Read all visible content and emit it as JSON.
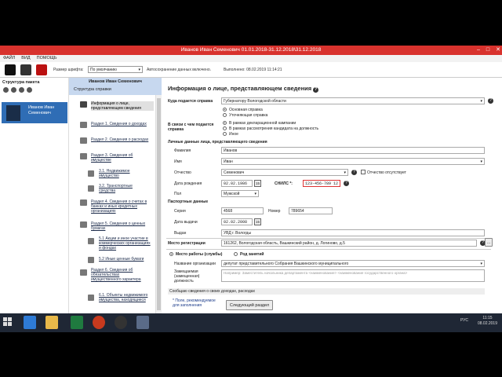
{
  "window": {
    "title": "Иванов Иван Семенович 01.01.2018-31.12.2018\\31.12.2018"
  },
  "menu": [
    "ФАЙЛ",
    "ВИД",
    "ПОМОЩЬ"
  ],
  "toolbar": {
    "font_size_label": "Размер шрифта:",
    "font_size_value": "По умолчанию",
    "autosave_text": "Автосохранение данных включено.",
    "done_text": "Выполнено: 08.02.2019 11:14:21"
  },
  "left_panel": {
    "title": "Структура пакета",
    "user_name": "Иванов Иван Семенович"
  },
  "mid_panel": {
    "header_name": "Иванов Иван Семенович",
    "subtitle": "Структура справки",
    "items": [
      "Информация о лице, представляющем сведения",
      "Раздел 1. Сведения о доходах",
      "Раздел 2. Сведения о расходах",
      "Раздел 3. Сведения об имуществе",
      "3.1. Недвижимое имущество",
      "3.2. Транспортные средства",
      "Раздел 4. Сведения о счетах в банках и иных кредитных организациях",
      "Раздел 5. Сведения о ценных бумагах",
      "5.1 Акции и иное участие в коммерческих организациях и фондах",
      "5.2 Иные ценные бумаги",
      "Раздел 6. Сведения об обязательствах имущественного характера",
      "6.1. Объекты недвижимого имущества, находящиеся"
    ]
  },
  "form": {
    "heading": "Информация о лице, представляющем сведения",
    "where_label": "Куда подается справка",
    "where_value": "Губернатору Вологодской области",
    "radio_main": "Основная справка",
    "radio_clarify": "Уточняющая справка",
    "reason_label": "В связи с чем подается справка",
    "reason_1": "В рамках декларационной кампании",
    "reason_2": "В рамках рассмотрения кандидата на должность",
    "reason_3": "Иное",
    "personal_title": "Личные данные лица, представляющего сведения",
    "surname_label": "Фамилия",
    "surname_value": "Иванов",
    "name_label": "Имя",
    "name_value": "Иван",
    "patronymic_label": "Отчество",
    "patronymic_value": "Семенович",
    "no_patronymic_label": "Отчество отсутствует",
    "birthdate_label": "Дата рождения",
    "birthdate_value": "02.02.1986",
    "snils_label": "СНИЛС *:",
    "snils_value": "123-456-789 12",
    "sex_label": "Пол",
    "sex_value": "Мужской",
    "passport_title": "Паспортные данные",
    "series_label": "Серия",
    "series_value": "4568",
    "number_label": "Номер",
    "number_value": "789654",
    "issued_date_label": "Дата выдачи",
    "issued_date_value": "02.02.2008",
    "issued_by_label": "Выдан",
    "issued_by_value": "УВД г. Вологды",
    "reg_label": "Место регистрации",
    "reg_value": "161262, Вологодская область, Вашкинский район, д. Логиново, д.5",
    "work_radio": "Место работы (службы)",
    "noemp_radio": "Род занятий",
    "org_label": "Название организации",
    "org_value": "депутат представительного Собрания Вашкинского муниципального",
    "position_label": "Замещаемая (замещенная) должность",
    "position_placeholder": "Например: Заместитель начальника департамента <наименование> <наименование государственного органа>",
    "income_note": "Сообщаю сведения о своих доходах, расходах",
    "hint_text": "* Поле, рекомендуемое для заполнения",
    "next_button": "Следующий раздел"
  },
  "taskbar": {
    "lang": "РУС",
    "time": "11:15",
    "date": "08.02.2019"
  }
}
